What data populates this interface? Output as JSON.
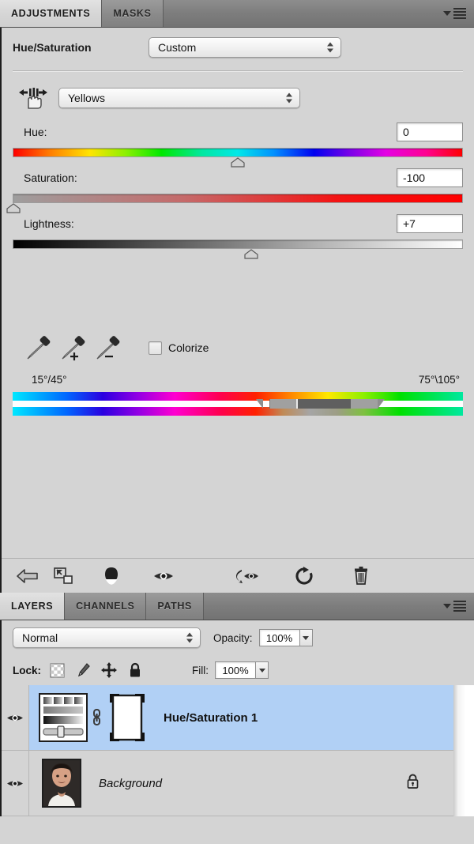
{
  "adjustments": {
    "tabs": [
      {
        "label": "ADJUSTMENTS",
        "active": true
      },
      {
        "label": "MASKS",
        "active": false
      }
    ],
    "menu_icon": "panel-menu-icon",
    "title": "Hue/Saturation",
    "preset": {
      "value": "Custom",
      "icon": "chevron-updown-icon"
    },
    "scrub_icon": "on-image-adjustment-icon",
    "color_range": {
      "value": "Yellows",
      "icon": "chevron-updown-icon"
    },
    "sliders": [
      {
        "name": "hue",
        "label": "Hue:",
        "value": "0",
        "thumb_pct": 50
      },
      {
        "name": "saturation",
        "label": "Saturation:",
        "value": "-100",
        "thumb_pct": 0
      },
      {
        "name": "lightness",
        "label": "Lightness:",
        "value": "+7",
        "thumb_pct": 53
      }
    ],
    "eyedroppers": [
      {
        "name": "eyedropper-sample-icon",
        "mod": ""
      },
      {
        "name": "eyedropper-add-icon",
        "mod": "+"
      },
      {
        "name": "eyedropper-subtract-icon",
        "mod": "−"
      }
    ],
    "colorize": {
      "label": "Colorize",
      "checked": false
    },
    "range_labels": {
      "left": "15°/45°",
      "right": "75°\\105°"
    },
    "footer_icons": [
      "back-arrow-icon",
      "expand-view-icon",
      "clip-to-layer-icon",
      "toggle-visibility-icon",
      "preview-previous-icon",
      "reset-icon",
      "delete-icon"
    ]
  },
  "layers": {
    "tabs": [
      {
        "label": "LAYERS",
        "active": true
      },
      {
        "label": "CHANNELS",
        "active": false
      },
      {
        "label": "PATHS",
        "active": false
      }
    ],
    "menu_icon": "panel-menu-icon",
    "blend_mode": "Normal",
    "opacity_label": "Opacity:",
    "opacity_value": "100%",
    "lock_label": "Lock:",
    "lock_icons": [
      "lock-transparency-icon",
      "lock-image-icon",
      "lock-position-icon",
      "lock-all-icon"
    ],
    "fill_label": "Fill:",
    "fill_value": "100%",
    "rows": [
      {
        "name": "Hue/Saturation 1",
        "selected": true,
        "visible": true,
        "kind": "adjustment",
        "linked": true,
        "has_mask": true,
        "locked": false
      },
      {
        "name": "Background",
        "selected": false,
        "visible": true,
        "kind": "image",
        "linked": false,
        "has_mask": false,
        "locked": true
      }
    ]
  },
  "colors": {
    "panel_bg": "#d4d4d4",
    "tab_inactive": "#8a8a8a",
    "tab_active": "#d9d9d9",
    "selection_blue": "#b1d0f5",
    "text": "#111111"
  }
}
